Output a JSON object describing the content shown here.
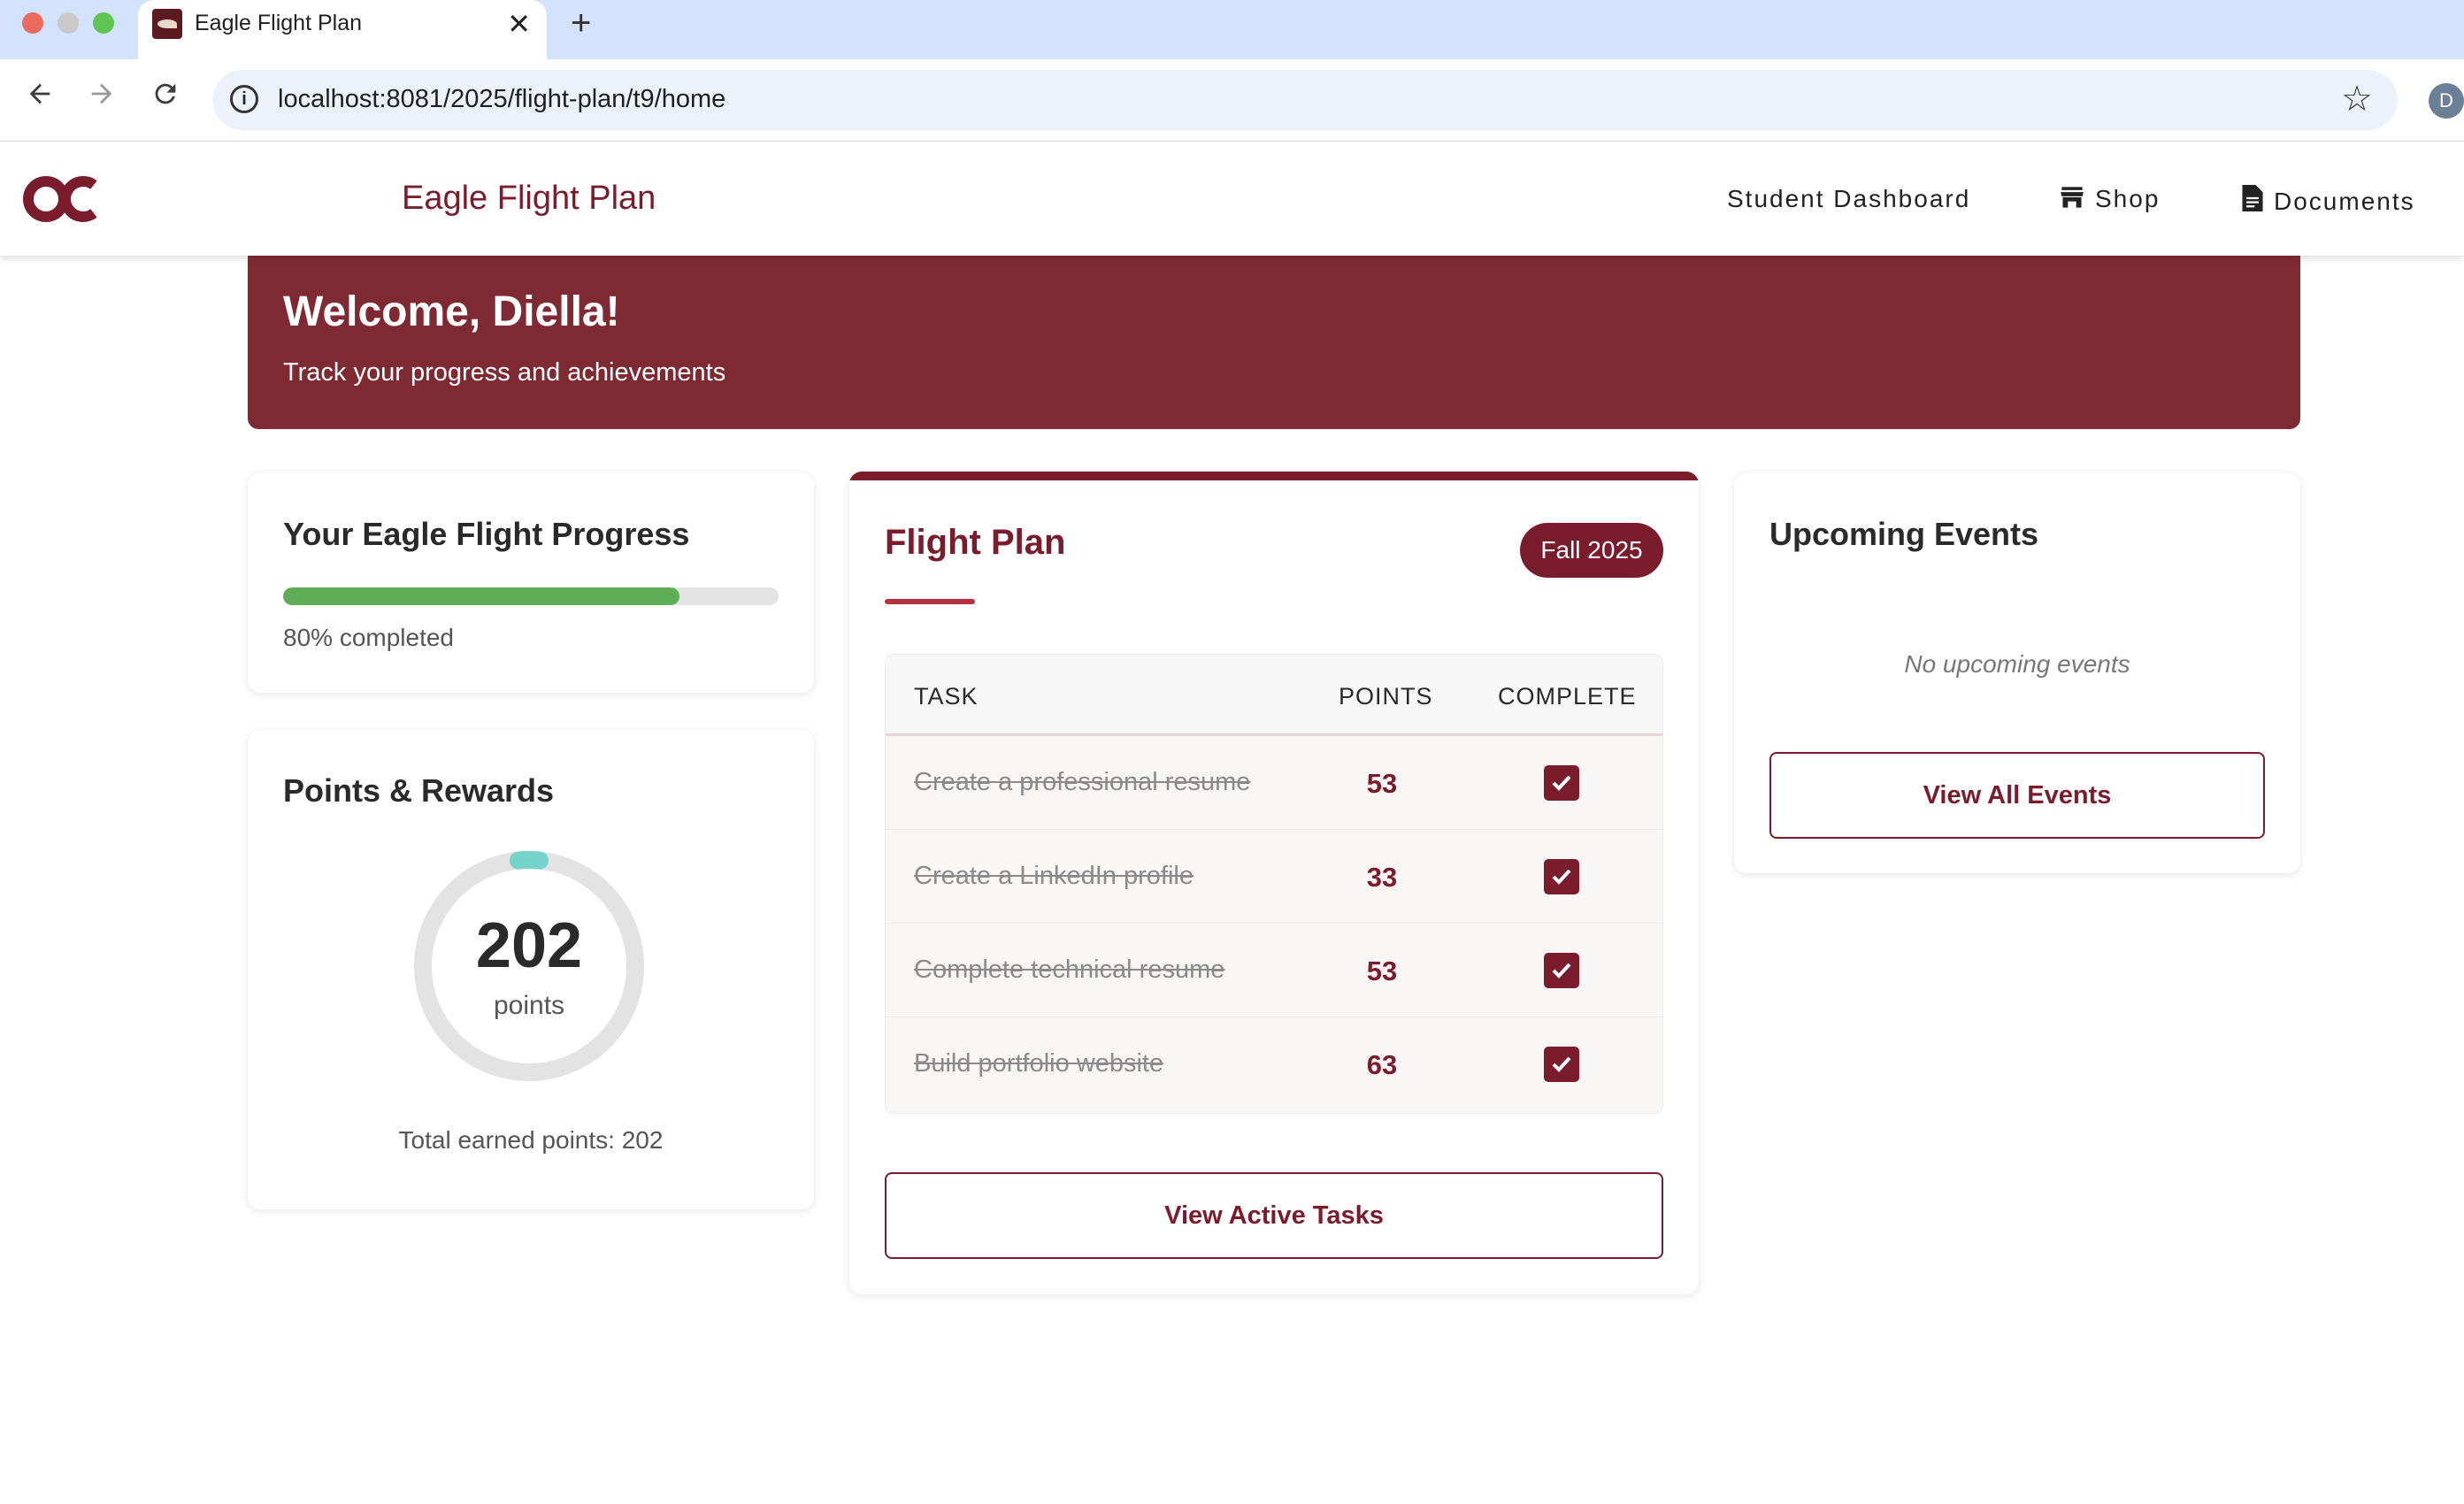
{
  "browser": {
    "tab_title": "Eagle Flight Plan",
    "tab_close": "✕",
    "new_tab": "+",
    "url": "localhost:8081/2025/flight-plan/t9/home",
    "profile_initial": "D"
  },
  "header": {
    "app_title": "Eagle Flight Plan",
    "nav": {
      "dashboard": "Student Dashboard",
      "shop": "Shop",
      "documents": "Documents"
    },
    "brand_color": "#7b1c2c"
  },
  "welcome": {
    "title": "Welcome, Diella!",
    "subtitle": "Track your progress and achievements"
  },
  "progress": {
    "title": "Your Eagle Flight Progress",
    "percent": 80,
    "label": "80% completed"
  },
  "points": {
    "title": "Points & Rewards",
    "value": "202",
    "unit": "points",
    "total_label": "Total earned points: 202"
  },
  "flight_plan": {
    "title": "Flight Plan",
    "term": "Fall 2025",
    "columns": {
      "task": "TASK",
      "points": "POINTS",
      "complete": "COMPLETE"
    },
    "tasks": [
      {
        "name": "Create a professional resume",
        "points": "53",
        "complete": true
      },
      {
        "name": "Create a LinkedIn profile",
        "points": "33",
        "complete": true
      },
      {
        "name": "Complete technical resume",
        "points": "53",
        "complete": true
      },
      {
        "name": "Build portfolio website",
        "points": "63",
        "complete": true
      }
    ],
    "button": "View Active Tasks"
  },
  "events": {
    "title": "Upcoming Events",
    "empty": "No upcoming events",
    "button": "View All Events"
  }
}
